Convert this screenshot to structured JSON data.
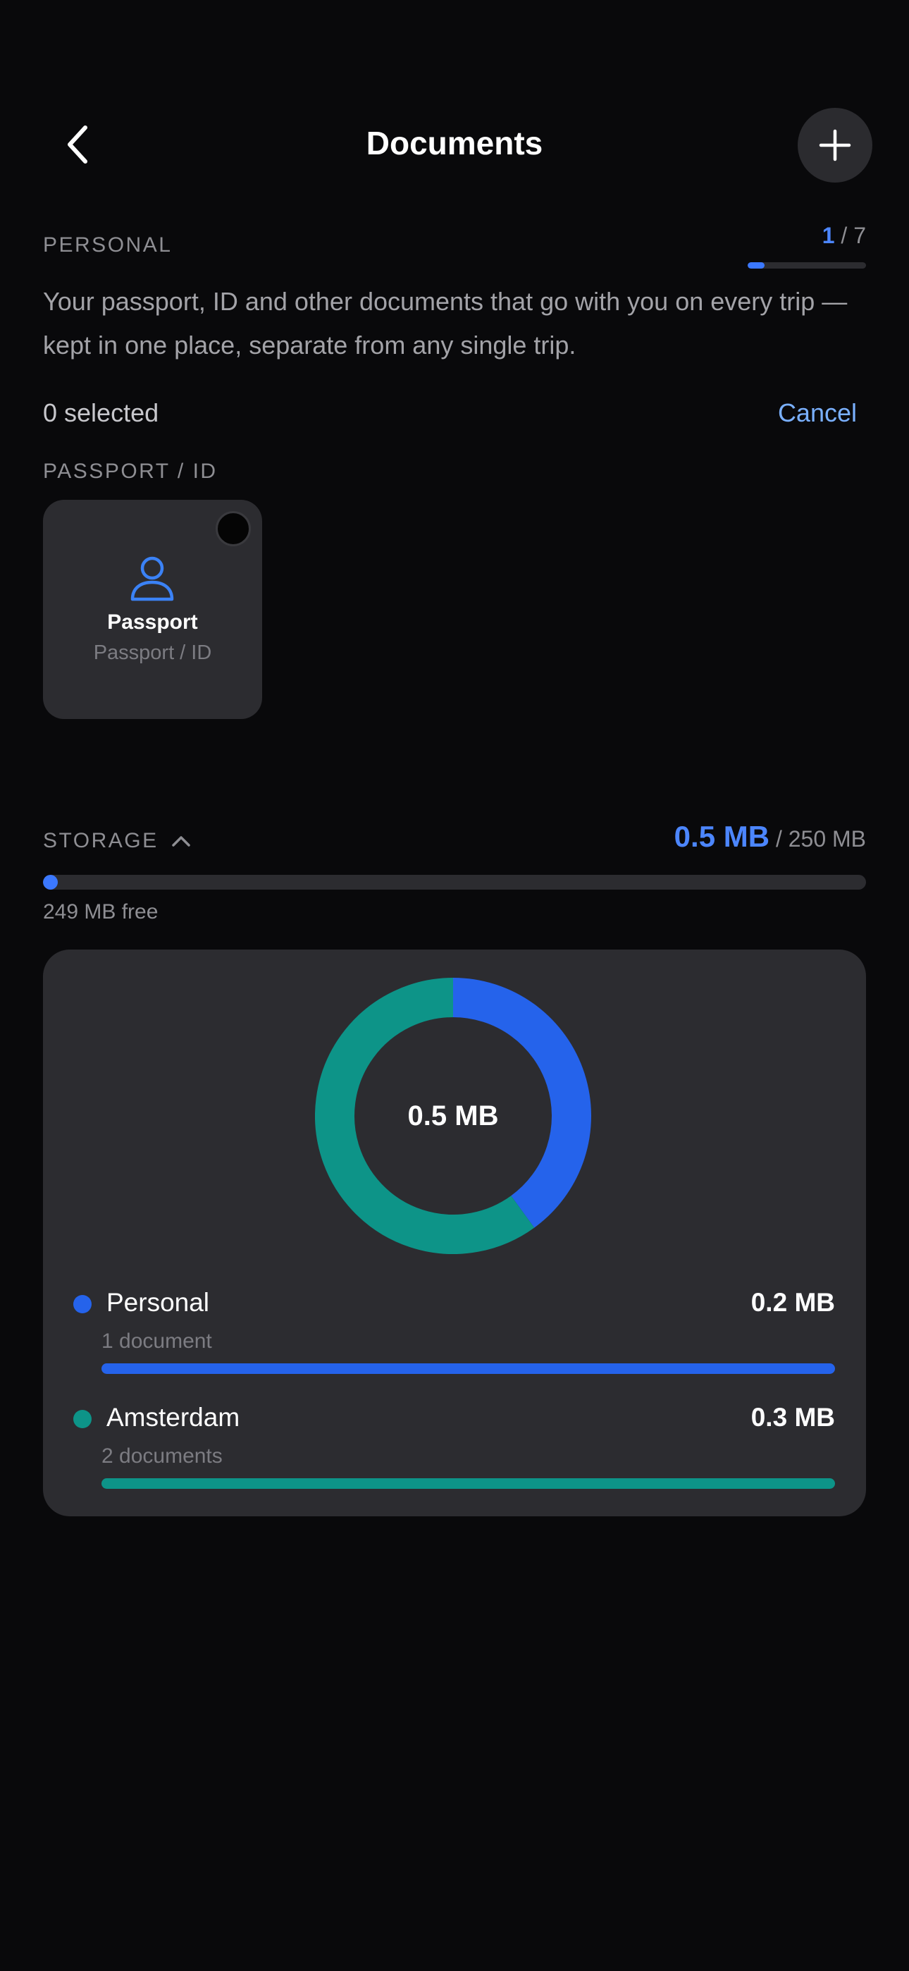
{
  "header": {
    "title": "Documents",
    "back_icon": "chevron-left-icon",
    "add_icon": "plus-icon"
  },
  "personal": {
    "label": "PERSONAL",
    "counter_current": "1",
    "counter_total": "/ 7",
    "progress_fraction": 0.14,
    "description": "Your passport, ID and other documents that go with you on every trip — kept in one place, separate from any single trip.",
    "selected_text": "0 selected",
    "cancel_label": "Cancel"
  },
  "group": {
    "label": "PASSPORT / ID",
    "documents": [
      {
        "name": "Passport",
        "type": "Passport / ID",
        "icon": "person-icon"
      }
    ]
  },
  "storage": {
    "label": "STORAGE",
    "used": "0.5 MB",
    "total": "/ 250 MB",
    "used_fraction": 0.002,
    "free_text": "249 MB free",
    "chart_center": "0.5 MB",
    "breakdown": [
      {
        "name": "Personal",
        "size": "0.2 MB",
        "count": "1 document",
        "color": "#2563eb",
        "value": 0.2
      },
      {
        "name": "Amsterdam",
        "size": "0.3 MB",
        "count": "2 documents",
        "color": "#0d9488",
        "value": 0.3
      }
    ]
  },
  "colors": {
    "background": "#09090b",
    "surface": "#2c2c30",
    "accent": "#4c86ff",
    "teal": "#0d9488"
  }
}
